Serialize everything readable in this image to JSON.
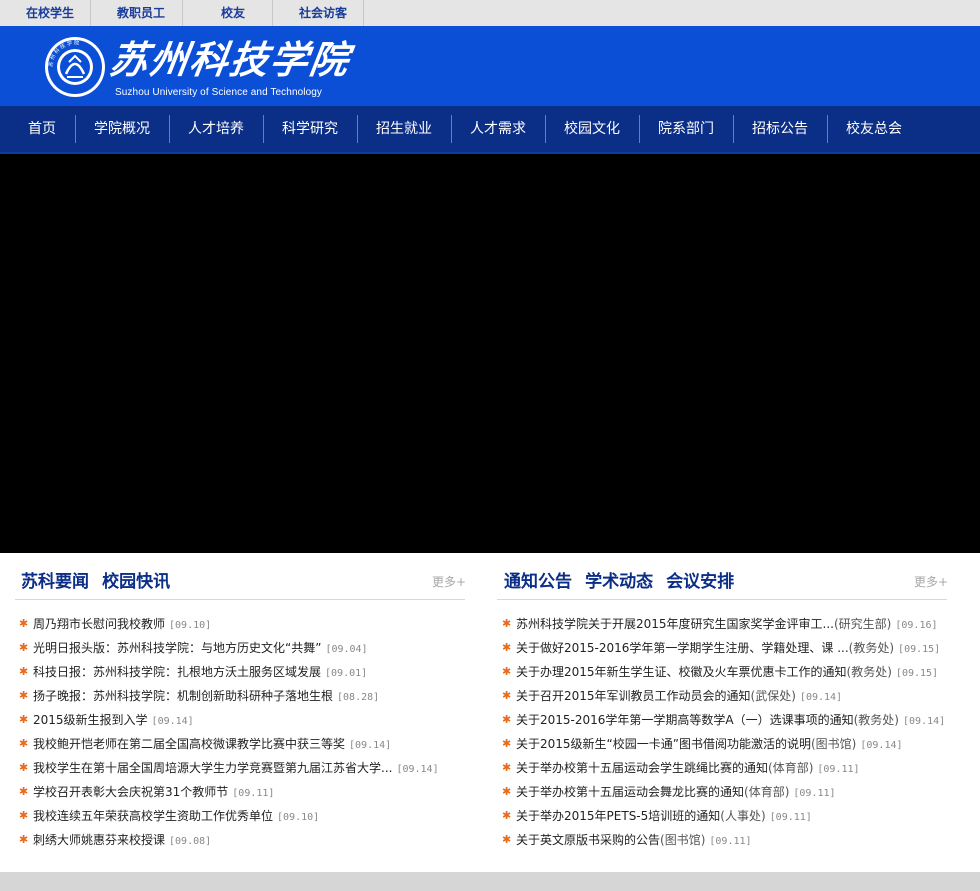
{
  "top_links": [
    "在校学生",
    "教职员工",
    "校友",
    "社会访客"
  ],
  "header": {
    "school_name_cn": "苏州科技学院",
    "school_name_en": "Suzhou University of Science and Technology",
    "emblem_ring_text": "苏州科技学院"
  },
  "nav": [
    "首页",
    "学院概况",
    "人才培养",
    "科学研究",
    "招生就业",
    "人才需求",
    "校园文化",
    "院系部门",
    "招标公告",
    "校友总会"
  ],
  "left_panel": {
    "tabs": [
      "苏科要闻",
      "校园快讯"
    ],
    "more_label": "更多+",
    "items": [
      {
        "title": "周乃翔市长慰问我校教师",
        "date": "[09.10]"
      },
      {
        "title": "光明日报头版：苏州科技学院：与地方历史文化“共舞”",
        "date": "[09.04]"
      },
      {
        "title": "科技日报：苏州科技学院：扎根地方沃土服务区域发展",
        "date": "[09.01]"
      },
      {
        "title": "扬子晚报：苏州科技学院：机制创新助科研种子落地生根",
        "date": "[08.28]"
      },
      {
        "title": "2015级新生报到入学",
        "date": "[09.14]"
      },
      {
        "title": "我校鲍开恺老师在第二届全国高校微课教学比赛中获三等奖",
        "date": "[09.14]"
      },
      {
        "title": "我校学生在第十届全国周培源大学生力学竞赛暨第九届江苏省大学...",
        "date": "[09.14]"
      },
      {
        "title": "学校召开表彰大会庆祝第31个教师节",
        "date": "[09.11]"
      },
      {
        "title": "我校连续五年荣获高校学生资助工作优秀单位",
        "date": "[09.10]"
      },
      {
        "title": "刺绣大师姚惠芬来校授课",
        "date": "[09.08]"
      }
    ]
  },
  "right_panel": {
    "tabs": [
      "通知公告",
      "学术动态",
      "会议安排"
    ],
    "more_label": "更多+",
    "items": [
      {
        "title": "苏州科技学院关于开展2015年度研究生国家奖学金评审工...",
        "dept": "(研究生部)",
        "date": "[09.16]"
      },
      {
        "title": "关于做好2015-2016学年第一学期学生注册、学籍处理、课 ...",
        "dept": "(教务处)",
        "date": "[09.15]"
      },
      {
        "title": "关于办理2015年新生学生证、校徽及火车票优惠卡工作的通知",
        "dept": "(教务处)",
        "date": "[09.15]"
      },
      {
        "title": "关于召开2015年军训教员工作动员会的通知",
        "dept": "(武保处)",
        "date": "[09.14]"
      },
      {
        "title": "关于2015-2016学年第一学期高等数学A（一）选课事项的通知",
        "dept": "(教务处)",
        "date": "[09.14]"
      },
      {
        "title": "关于2015级新生“校园一卡通”图书借阅功能激活的说明",
        "dept": "(图书馆)",
        "date": "[09.14]"
      },
      {
        "title": "关于举办校第十五届运动会学生跳绳比赛的通知",
        "dept": "(体育部)",
        "date": "[09.11]"
      },
      {
        "title": "关于举办校第十五届运动会舞龙比赛的通知",
        "dept": "(体育部)",
        "date": "[09.11]"
      },
      {
        "title": "关于举办2015年PETS-5培训班的通知",
        "dept": "(人事处)",
        "date": "[09.11]"
      },
      {
        "title": "关于英文原版书采购的公告",
        "dept": "(图书馆)",
        "date": "[09.11]"
      }
    ]
  },
  "colors": {
    "header_blue": "#0b4fd6",
    "nav_navy": "#0b2e87",
    "bullet_orange": "#e86a1c",
    "banner_black": "#000000"
  }
}
